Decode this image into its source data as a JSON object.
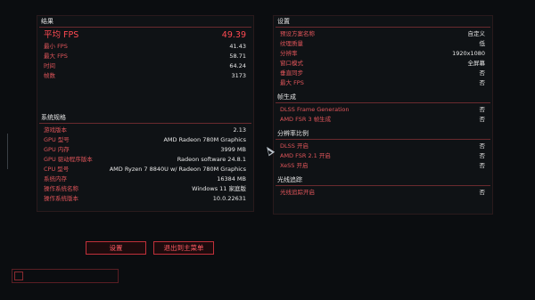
{
  "results": {
    "title": "结果",
    "avg_fps": {
      "label": "平均 FPS",
      "value": "49.39"
    },
    "rows": [
      {
        "label": "最小 FPS",
        "value": "41.43"
      },
      {
        "label": "最大 FPS",
        "value": "58.71"
      },
      {
        "label": "时间",
        "value": "64.24"
      },
      {
        "label": "帧数",
        "value": "3173"
      }
    ]
  },
  "system": {
    "title": "系统规格",
    "rows": [
      {
        "label": "游戏版本",
        "value": "2.13"
      },
      {
        "label": "GPU 型号",
        "value": "AMD Radeon 780M Graphics"
      },
      {
        "label": "GPU 内存",
        "value": "3999 MB"
      },
      {
        "label": "GPU 驱动程序版本",
        "value": "Radeon software 24.8.1"
      },
      {
        "label": "CPU 型号",
        "value": "AMD Ryzen 7 8840U w/ Radeon 780M Graphics"
      },
      {
        "label": "系统内存",
        "value": "16384 MB"
      },
      {
        "label": "操作系统名称",
        "value": "Windows 11 家庭版"
      },
      {
        "label": "操作系统版本",
        "value": "10.0.22631"
      }
    ]
  },
  "settings": {
    "title": "设置",
    "rows": [
      {
        "label": "预设方案名称",
        "value": "自定义"
      },
      {
        "label": "纹理质量",
        "value": "低"
      },
      {
        "label": "分辨率",
        "value": "1920x1080"
      },
      {
        "label": "窗口模式",
        "value": "全屏幕"
      },
      {
        "label": "垂直同步",
        "value": "否"
      },
      {
        "label": "最大 FPS",
        "value": "否"
      }
    ]
  },
  "frame_gen": {
    "title": "帧生成",
    "rows": [
      {
        "label": "DLSS Frame Generation",
        "value": "否"
      },
      {
        "label": "AMD FSR 3 帧生成",
        "value": "否"
      }
    ]
  },
  "resolution_scaling": {
    "title": "分辨率比例",
    "rows": [
      {
        "label": "DLSS 开启",
        "value": "否"
      },
      {
        "label": "AMD FSR 2.1 开启",
        "value": "否"
      },
      {
        "label": "XeSS 开启",
        "value": "否"
      }
    ]
  },
  "ray_tracing": {
    "title": "光线追踪",
    "rows": [
      {
        "label": "光线追踪开启",
        "value": "否"
      }
    ]
  },
  "buttons": {
    "settings": "设置",
    "exit": "退出到主菜单"
  },
  "colors": {
    "accent": "#ff4a52",
    "label": "#e0555a",
    "value": "#e8e8e8",
    "background": "#0b0d10"
  }
}
